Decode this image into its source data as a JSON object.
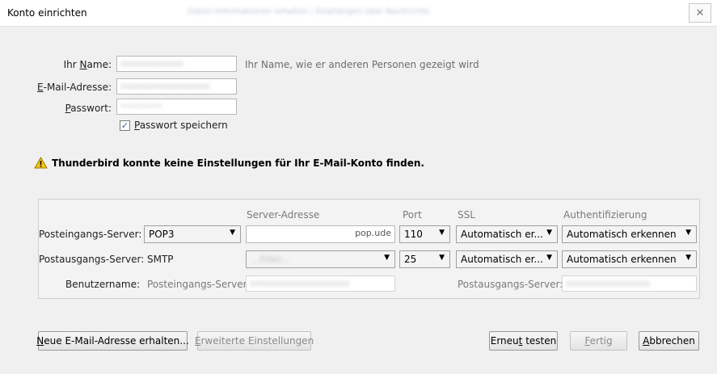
{
  "window": {
    "title": "Konto einrichten",
    "subtitle_blurred": "Daten-Informationen erhalten / Empfangen über Nachrichten",
    "close_symbol": "✕"
  },
  "form": {
    "name_label": "Ihr Name:",
    "name_hint": "Ihr Name, wie er anderen Personen gezeigt wird",
    "email_label": "E-Mail-Adresse:",
    "password_label": "Passwort:",
    "password_value": "••••••••",
    "save_password_label": "Passwort speichern",
    "save_password_checked": true
  },
  "warning": {
    "icon": "warning-icon",
    "text": "Thunderbird konnte keine Einstellungen für Ihr E-Mail-Konto finden."
  },
  "server": {
    "headers": {
      "address": "Server-Adresse",
      "port": "Port",
      "ssl": "SSL",
      "auth": "Authentifizierung"
    },
    "incoming": {
      "label": "Posteingangs-Server:",
      "type": "POP3",
      "address": "pop.ude",
      "port": "110",
      "ssl": "Automatisch er...",
      "auth": "Automatisch erkennen"
    },
    "outgoing": {
      "label": "Postausgangs-Server:",
      "type": "SMTP",
      "address": "...hiler...",
      "port": "25",
      "ssl": "Automatisch er...",
      "auth": "Automatisch erkennen"
    },
    "username": {
      "label": "Benutzername:",
      "incoming_label": "Posteingangs-Server:",
      "outgoing_label": "Postausgangs-Server:"
    }
  },
  "buttons": {
    "new_email": "Neue E-Mail-Adresse erhalten...",
    "advanced": "Erweiterte Einstellungen",
    "retest": "Erneut testen",
    "done": "Fertig",
    "cancel": "Abbrechen"
  }
}
